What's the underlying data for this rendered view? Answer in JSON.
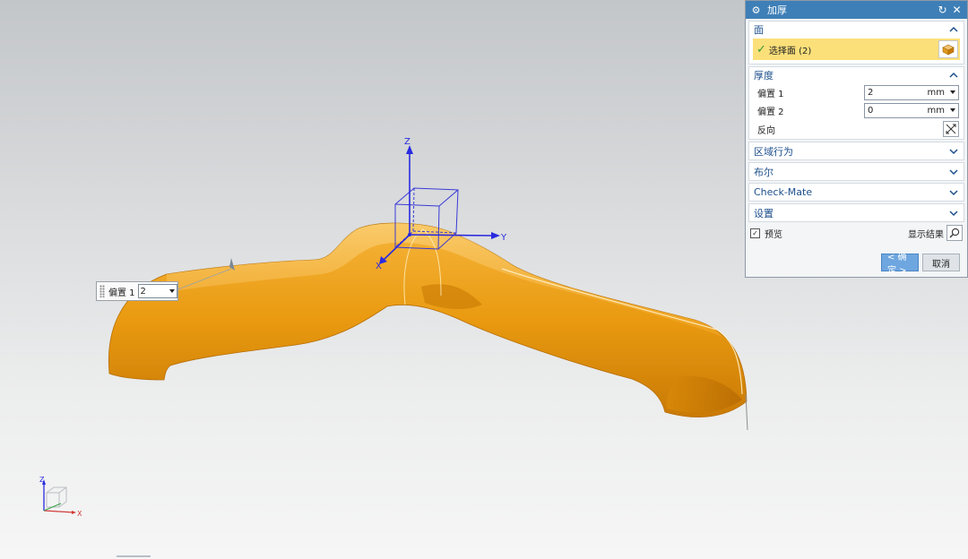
{
  "viewport": {
    "axis_labels": {
      "z": "Z",
      "y": "Y",
      "x": "X"
    },
    "onscreen_offset": {
      "label": "偏置 1",
      "value": "2"
    },
    "triad_labels": {
      "z": "Z",
      "x": "X"
    }
  },
  "dialog": {
    "title": "加厚",
    "icons": {
      "app": "gear-icon",
      "reset": "reset-icon",
      "close": "close-icon"
    },
    "face_section": {
      "title": "面",
      "select_label": "选择面 (2)"
    },
    "thickness_section": {
      "title": "厚度",
      "offset1_label": "偏置 1",
      "offset1_value": "2",
      "offset1_unit": "mm",
      "offset2_label": "偏置 2",
      "offset2_value": "0",
      "offset2_unit": "mm",
      "reverse_label": "反向"
    },
    "collapsed_sections": [
      "区域行为",
      "布尔",
      "Check-Mate",
      "设置"
    ],
    "preview_label": "预览",
    "preview_checked": true,
    "show_result_label": "显示结果",
    "ok_label": "< 确定 >",
    "cancel_label": "取消"
  },
  "colors": {
    "titlebar": "#3e7fb7",
    "section_text": "#1c4f8c",
    "selection_highlight": "#fbe07a",
    "model": "#f0a11a"
  }
}
